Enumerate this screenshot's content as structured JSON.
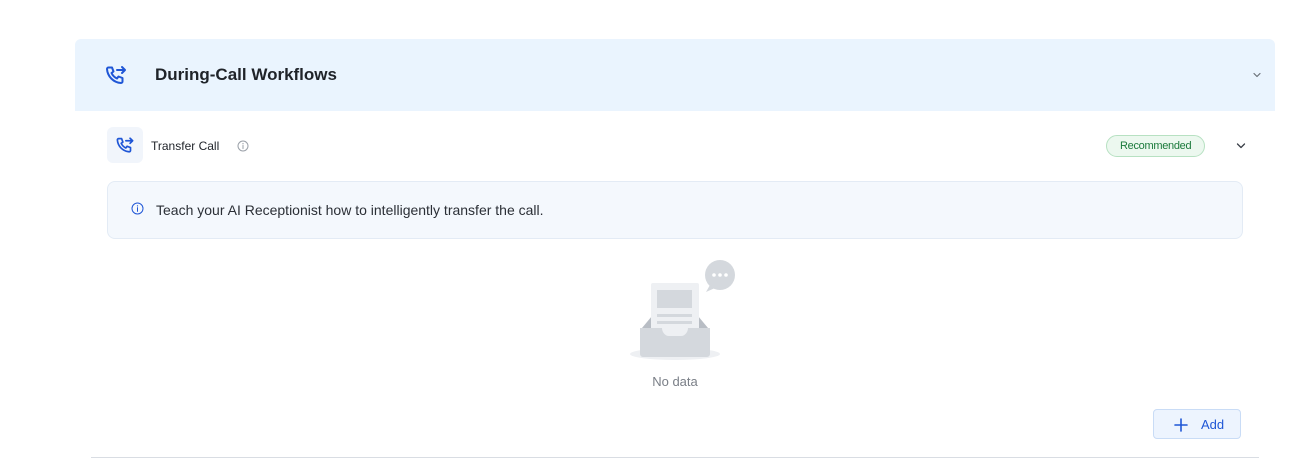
{
  "section": {
    "title": "During-Call Workflows",
    "icon": "phone-transfer-icon",
    "chevron_icon": "chevron-down-icon"
  },
  "item": {
    "title": "Transfer Call",
    "icon": "phone-transfer-icon",
    "info_icon": "info-circle-icon",
    "badge": "Recommended",
    "badge_color": "#1b7a3c",
    "chevron_icon": "chevron-down-icon"
  },
  "info_banner": {
    "icon": "info-circle-icon",
    "text": "Teach your AI Receptionist how to intelligently transfer the call."
  },
  "empty_state": {
    "icon": "empty-inbox-illustration",
    "text": "No data"
  },
  "add_button": {
    "icon": "plus-icon",
    "label": "Add"
  },
  "colors": {
    "accent": "#1f56d6",
    "header_background": "#eaf4fe"
  }
}
